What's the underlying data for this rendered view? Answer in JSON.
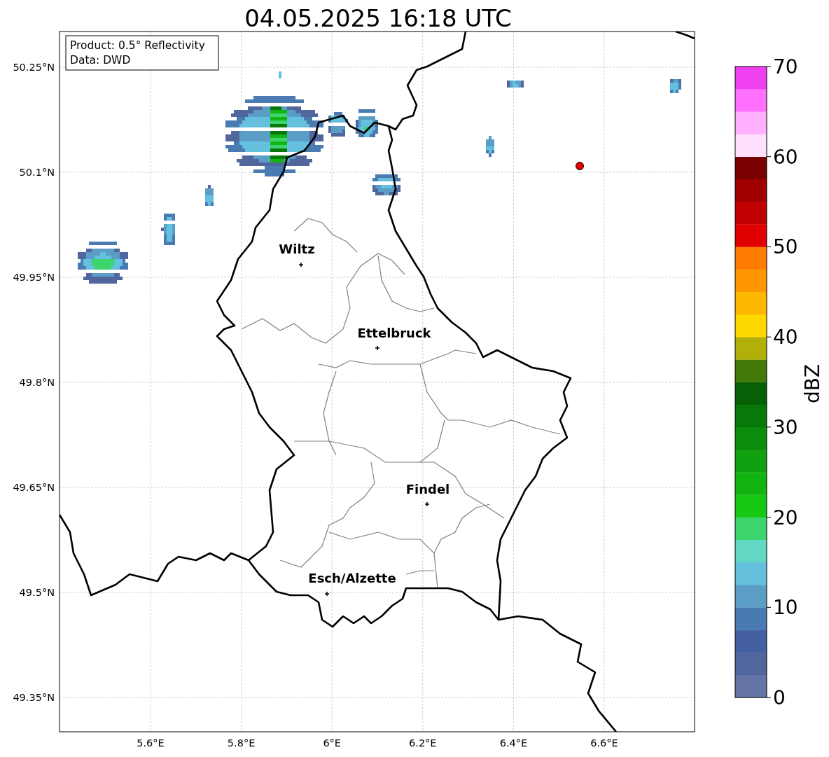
{
  "title": "04.05.2025 16:18 UTC",
  "info_box": [
    "Product: 0.5° Reflectivity",
    "Data: DWD"
  ],
  "map": {
    "lat_ticks": [
      "50.25°N",
      "50.1°N",
      "49.95°N",
      "49.8°N",
      "49.65°N",
      "49.5°N",
      "49.35°N"
    ],
    "lon_ticks": [
      "5.6°E",
      "5.8°E",
      "6°E",
      "6.2°E",
      "6.4°E",
      "6.6°E"
    ],
    "cities": [
      "Wiltz",
      "Ettelbruck",
      "Findel",
      "Esch/Alzette"
    ]
  },
  "colorbar": {
    "label": "dBZ",
    "ticks": [
      "70",
      "60",
      "50",
      "40",
      "30",
      "20",
      "10",
      "0"
    ],
    "segments": [
      {
        "color": "#6474a6"
      },
      {
        "color": "#52669e"
      },
      {
        "color": "#4460a2"
      },
      {
        "color": "#4a7ab2"
      },
      {
        "color": "#5a9ec6"
      },
      {
        "color": "#64c0dc"
      },
      {
        "color": "#62d8c4"
      },
      {
        "color": "#3cd46c"
      },
      {
        "color": "#14c814"
      },
      {
        "color": "#12b412"
      },
      {
        "color": "#10a010"
      },
      {
        "color": "#0c8c0c"
      },
      {
        "color": "#087808"
      },
      {
        "color": "#066006"
      },
      {
        "color": "#447808"
      },
      {
        "color": "#b0b008"
      },
      {
        "color": "#ffd800"
      },
      {
        "color": "#ffb800"
      },
      {
        "color": "#ff9800"
      },
      {
        "color": "#ff7c00"
      },
      {
        "color": "#e00000"
      },
      {
        "color": "#c00000"
      },
      {
        "color": "#a00000"
      },
      {
        "color": "#780000"
      },
      {
        "color": "#ffe0ff"
      },
      {
        "color": "#ffb0ff"
      },
      {
        "color": "#ff70ff"
      },
      {
        "color": "#ee40ee"
      }
    ]
  }
}
